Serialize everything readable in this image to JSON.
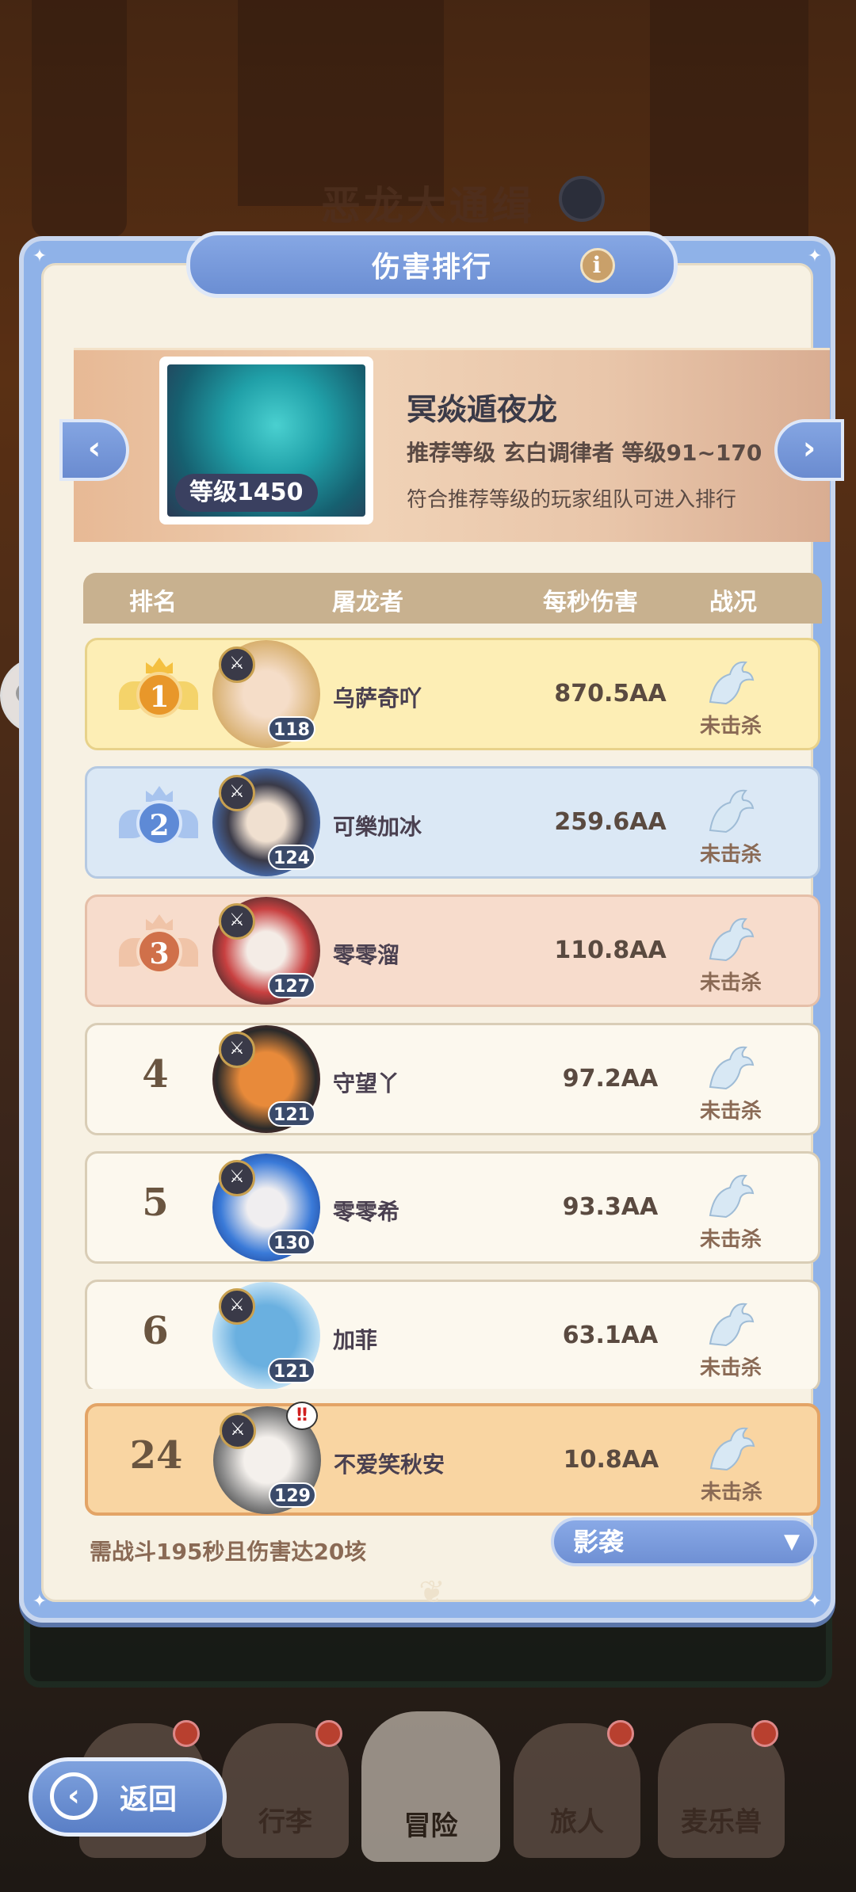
{
  "background": {
    "title": "恶龙大通缉"
  },
  "panel": {
    "title": "伤害排行"
  },
  "boss": {
    "name": "冥焱遁夜龙",
    "level_badge": "等级1450",
    "requirement": "推荐等级  玄白调律者  等级91~170",
    "note": "符合推荐等级的玩家组队可进入排行"
  },
  "table": {
    "headers": [
      "排名",
      "屠龙者",
      "每秒伤害",
      "战况"
    ]
  },
  "rows": [
    {
      "rank": "1",
      "level": "118",
      "name": "乌萨奇吖",
      "dps": "870.5AA",
      "status": "未击杀",
      "avatar_color": "#e8c9a8"
    },
    {
      "rank": "2",
      "level": "124",
      "name": "可樂加冰",
      "dps": "259.6AA",
      "status": "未击杀",
      "avatar_color": "#4a78c8"
    },
    {
      "rank": "3",
      "level": "127",
      "name": "零零溜",
      "dps": "110.8AA",
      "status": "未击杀",
      "avatar_color": "#c84040"
    },
    {
      "rank": "4",
      "level": "121",
      "name": "守望丫",
      "dps": "97.2AA",
      "status": "未击杀",
      "avatar_color": "#e07a2a"
    },
    {
      "rank": "5",
      "level": "130",
      "name": "零零希",
      "dps": "93.3AA",
      "status": "未击杀",
      "avatar_color": "#3a7ad8"
    },
    {
      "rank": "6",
      "level": "121",
      "name": "加菲",
      "dps": "63.1AA",
      "status": "未击杀",
      "avatar_color": "#6ab0e0"
    }
  ],
  "my_row": {
    "rank": "24",
    "level": "129",
    "name": "不爱笑秋安",
    "dps": "10.8AA",
    "status": "未击杀",
    "avatar_color": "#e6e6e6"
  },
  "footer": {
    "note": "需战斗195秒且伤害达20垓",
    "mode_selected": "影袭"
  },
  "bottom_nav": {
    "items": [
      "行李",
      "冒险",
      "旅人",
      "麦乐兽"
    ],
    "back_label": "返回"
  },
  "colors": {
    "accent_blue": "#6b8ed3",
    "gold_row": "#fdeeb5",
    "silver_row": "#dbe8f5",
    "bronze_row": "#f7dccc",
    "self_row": "#f9d5a2"
  }
}
